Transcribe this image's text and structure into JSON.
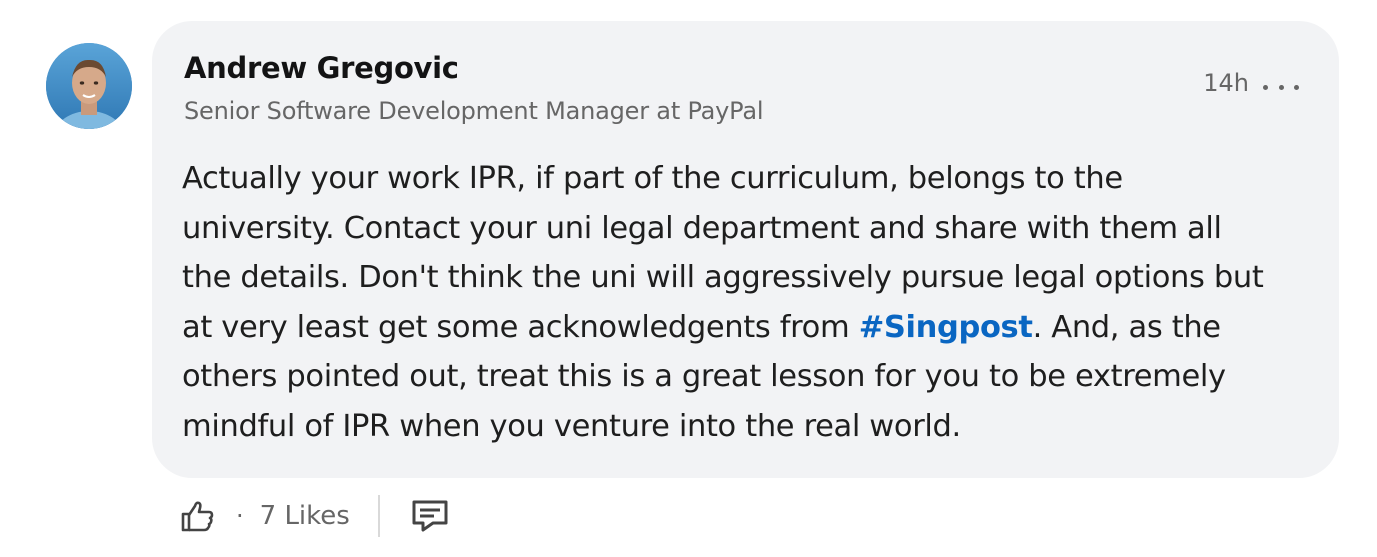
{
  "comment": {
    "author": {
      "name": "Andrew Gregovic",
      "headline": "Senior Software Development Manager at PayPal",
      "avatar_icon": "profile-photo"
    },
    "timestamp": "14h",
    "more_icon": "ellipsis-icon",
    "body": {
      "line1": "Actually your work IPR, if part of the curriculum, belongs to the",
      "line2": "university. Contact your uni legal department and share with them all",
      "line3": "the details. Don't think the uni will aggressively pursue legal options but",
      "line4_before": "at very least get some acknowledgents from ",
      "hashtag": "#Singpost",
      "line4_after": ". And, as the",
      "line5": "others pointed out, treat this is a great lesson for you to be extremely",
      "line6": "mindful of IPR when you venture into the real world."
    },
    "actions": {
      "like_icon": "thumbs-up-icon",
      "separator": "·",
      "likes_label": "7 Likes",
      "reply_icon": "comment-icon"
    },
    "colors": {
      "bubble": "#f2f3f5",
      "hashtag": "#0a66c2",
      "secondary_text": "#666666"
    }
  }
}
